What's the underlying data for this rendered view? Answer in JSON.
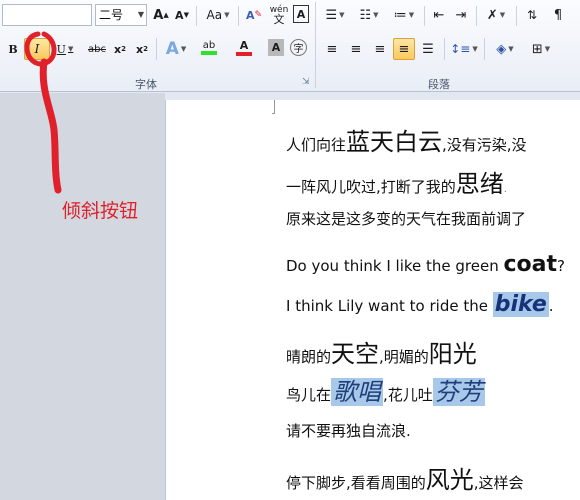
{
  "ribbon": {
    "font_size_value": "二号",
    "grow_font_label": "A",
    "shrink_font_label": "A",
    "change_case_label": "Aa",
    "clear_format_label": "A",
    "phonetic_label": "wén",
    "char_border_label": "A",
    "bold_label": "B",
    "italic_label": "I",
    "underline_label": "U",
    "strike_label": "abc",
    "subscript_label": "x",
    "superscript_label": "x",
    "text_effect_label": "A",
    "highlight_label": "ab",
    "font_color_label": "A",
    "char_shading_label": "A",
    "enclose_char_label": "字",
    "font_group_label": "字体",
    "paragraph_group_label": "段落"
  },
  "annotation": {
    "label": "倾斜按钮",
    "color": "#e0202a"
  },
  "document": {
    "lines": [
      {
        "pre": "人们向往",
        "big": "蓝天白云",
        "post": ",没有污染,没"
      },
      {
        "pre": "一阵风儿吹过,打断了我的",
        "big": "思绪",
        "post": "."
      },
      {
        "text": "原来这是这多变的天气在我面前调了"
      },
      {
        "pre": "Do you think I like the green ",
        "big": "coat",
        "post": "?"
      },
      {
        "pre": "I think Lily want to ride the ",
        "big": "bike",
        "post": "."
      },
      {
        "a": "晴朗的",
        "b": "天空",
        "c": ",明媚的",
        "d": "阳光",
        "e": ""
      },
      {
        "a": "鸟儿在",
        "b": "歌唱",
        "c": ",花儿吐",
        "d": "芬芳",
        "e": ""
      },
      {
        "text": "请不要再独自流浪."
      },
      {
        "pre": "停下脚步,看看周围的",
        "big": "风光",
        "post": ",这样会"
      }
    ]
  },
  "colors": {
    "selection": "#a8c8ea",
    "accent_red": "#e0202a",
    "ribbon_active": "#f9c95c"
  }
}
